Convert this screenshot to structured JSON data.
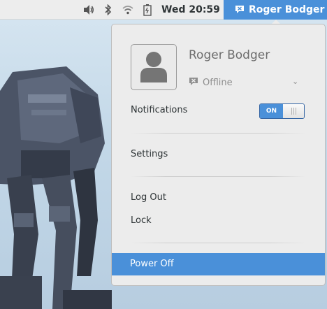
{
  "topbar": {
    "clock": "Wed 20:59",
    "user_name": "Roger Bodger",
    "icons": [
      "volume-icon",
      "bluetooth-icon",
      "wifi-icon",
      "battery-icon",
      "chat-status-icon"
    ]
  },
  "menu": {
    "user_name": "Roger Bodger",
    "status": "Offline",
    "notifications_label": "Notifications",
    "notifications_toggle": "ON",
    "settings": "Settings",
    "log_out": "Log Out",
    "lock": "Lock",
    "power_off": "Power Off"
  },
  "colors": {
    "accent": "#4a90d9",
    "menu_bg": "#ececec",
    "topbar_bg": "#ededed"
  }
}
